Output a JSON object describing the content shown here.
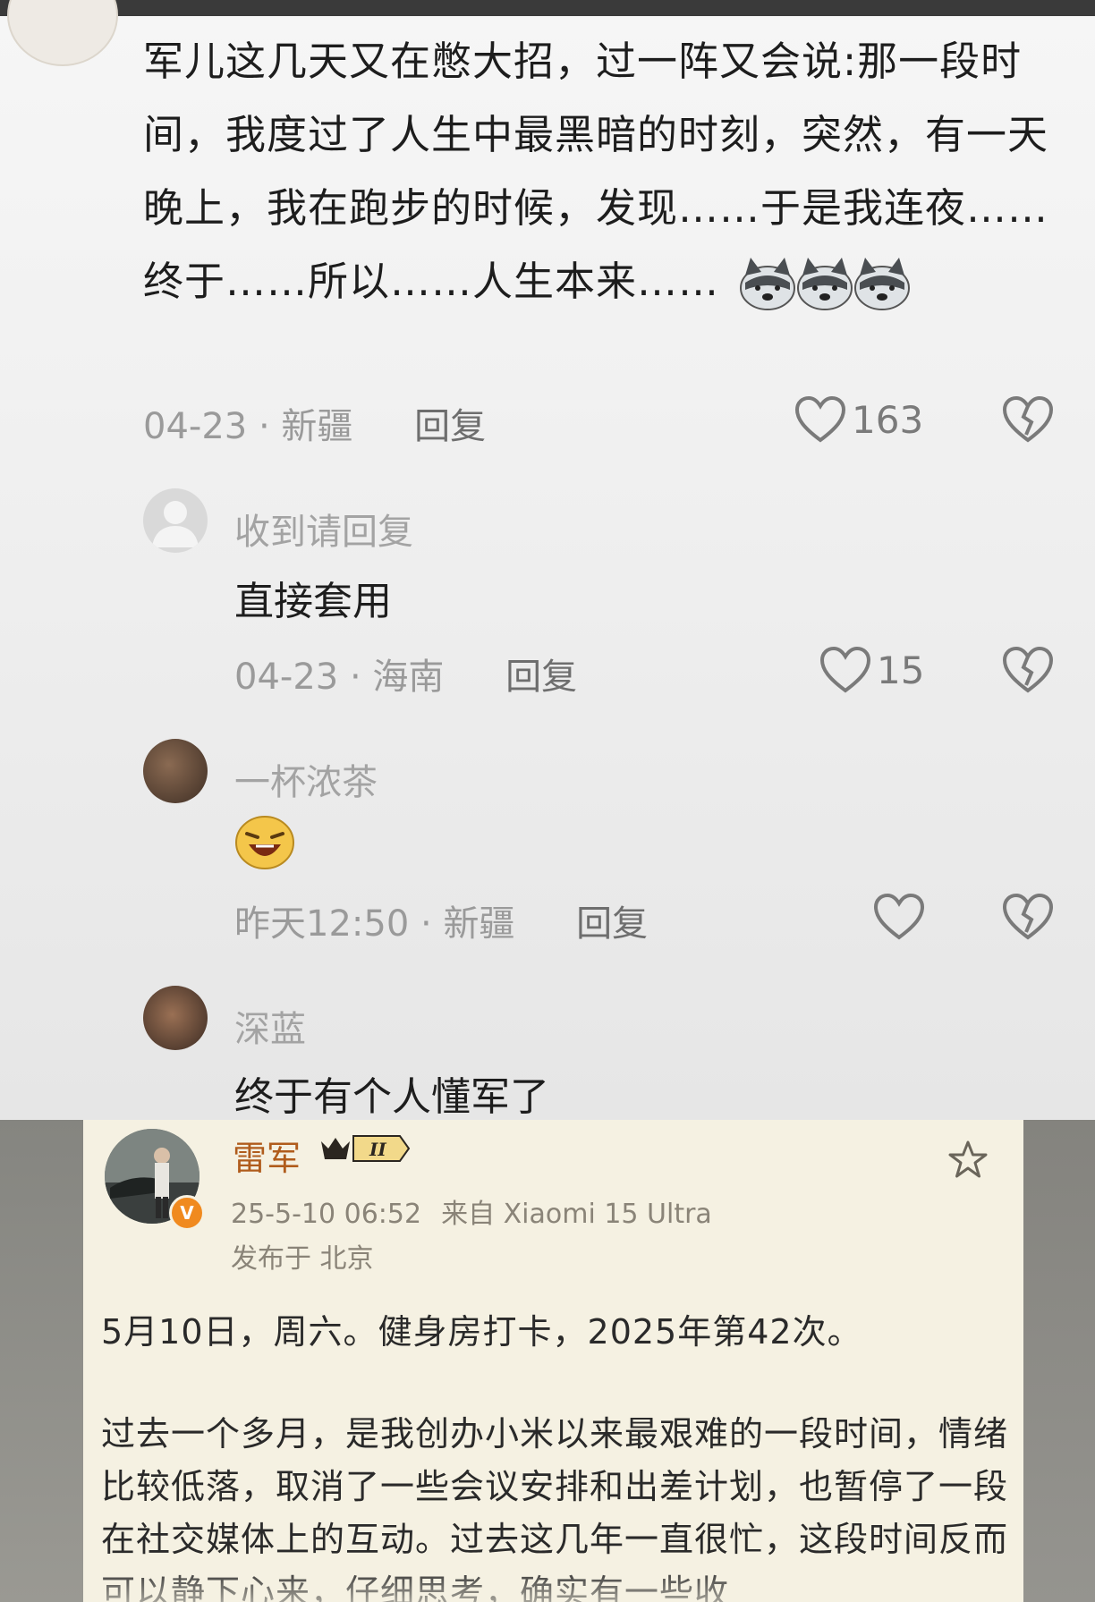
{
  "comment_main": {
    "text": "军儿这几天又在憋大招，过一阵又会说:那一段时间，我度过了人生中最黑暗的时刻，突然，有一天晚上，我在跑步的时候，发现……于是我连夜……终于……所以……人生本来……",
    "emoji_name": "husky-dog-emoji",
    "date": "04-23",
    "sep": "·",
    "location": "新疆",
    "reply_label": "回复",
    "likes": "163"
  },
  "reply_1": {
    "username": "收到请回复",
    "text": "直接套用",
    "date": "04-23",
    "sep": "·",
    "location": "海南",
    "reply_label": "回复",
    "likes": "15"
  },
  "reply_2": {
    "username": "一杯浓茶",
    "emoji_name": "laughing-emoji",
    "date": "昨天12:50",
    "sep": "·",
    "location": "新疆",
    "reply_label": "回复"
  },
  "reply_3": {
    "username": "深蓝",
    "text": "终于有个人懂军了"
  },
  "post": {
    "author": "雷军",
    "level": "II",
    "verified": "V",
    "timestamp": "25-5-10 06:52",
    "source": "来自 Xiaomi 15 Ultra",
    "location": "发布于 北京",
    "line1": "5月10日，周六。健身房打卡，2025年第42次。",
    "paragraph": "过去一个多月，是我创办小米以来最艰难的一段时间，情绪比较低落，取消了一些会议安排和出差计划，也暂停了一段在社交媒体上的互动。过去这几年一直很忙，这段时间反而可以静下心来，仔细思考，确实有一些收"
  },
  "colors": {
    "username_orange": "#b05c1c",
    "meta_gray": "#9a9a9a",
    "text_dark": "#1d1d1d",
    "card_bg": "#f5f1e2"
  }
}
